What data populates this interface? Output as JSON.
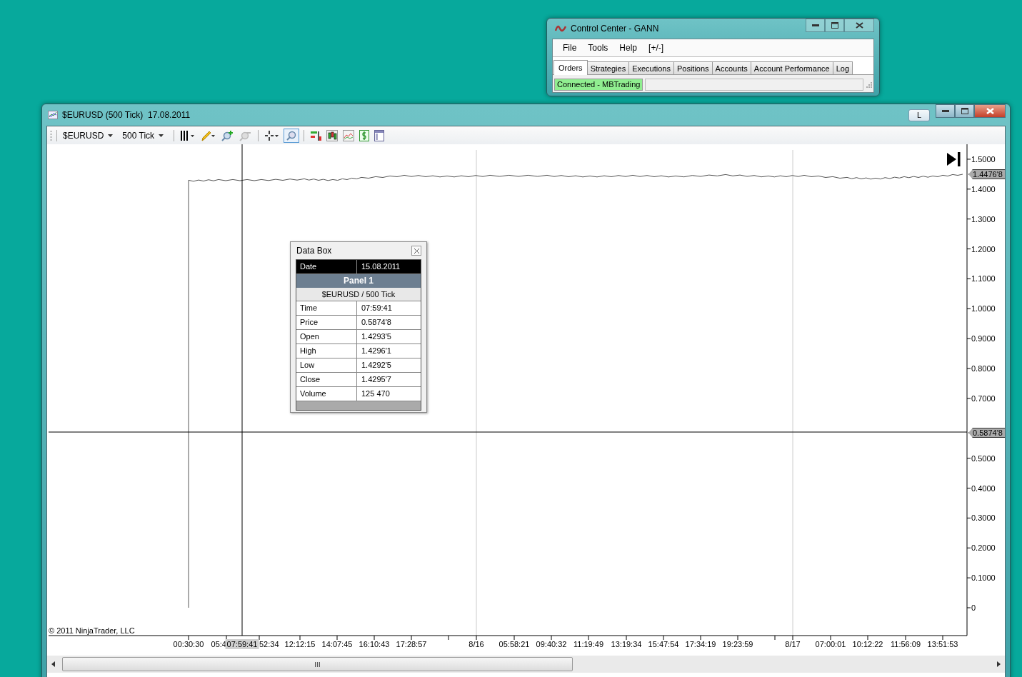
{
  "control_center": {
    "title": "Control Center - GANN",
    "menu": [
      "File",
      "Tools",
      "Help",
      "[+/-]"
    ],
    "tabs": [
      {
        "label": "Orders",
        "selected": true
      },
      {
        "label": "Strategies",
        "selected": false
      },
      {
        "label": "Executions",
        "selected": false
      },
      {
        "label": "Positions",
        "selected": false
      },
      {
        "label": "Accounts",
        "selected": false
      },
      {
        "label": "Account Performance",
        "selected": false
      },
      {
        "label": "Log",
        "selected": false
      }
    ],
    "status": "Connected - MBTrading"
  },
  "chart_window": {
    "title": "$EURUSD (500 Tick)  17.08.2011",
    "layout_button": "L",
    "toolbar": {
      "instrument": "$EURUSD",
      "interval": "500 Tick"
    },
    "price_axis": [
      "1.5000",
      "1.4000",
      "1.3000",
      "1.2000",
      "1.1000",
      "1.0000",
      "0.9000",
      "0.8000",
      "0.7000",
      "0.5000",
      "0.4000",
      "0.3000",
      "0.2000",
      "0.1000",
      "0"
    ],
    "last_price": "1.4476'8",
    "crosshair_price": "0.5874'8",
    "time_axis": [
      "00:30:30",
      "05:4",
      "52:34",
      "12:12:15",
      "14:07:45",
      "16:10:43",
      "17:28:57",
      "8/16",
      "05:58:21",
      "09:40:32",
      "11:19:49",
      "13:19:34",
      "15:47:54",
      "17:34:19",
      "19:23:59",
      "8/17",
      "07:00:01",
      "10:12:22",
      "11:56:09",
      "13:51:53"
    ],
    "crosshair_time": "07:59:41",
    "copyright": "© 2011 NinjaTrader, LLC"
  },
  "data_box": {
    "title": "Data Box",
    "date_label": "Date",
    "date_value": "15.08.2011",
    "panel": "Panel 1",
    "series": "$EURUSD / 500 Tick",
    "rows": [
      {
        "label": "Time",
        "value": "07:59:41"
      },
      {
        "label": "Price",
        "value": "0.5874'8"
      },
      {
        "label": "Open",
        "value": "1.4293'5"
      },
      {
        "label": "High",
        "value": "1.4296'1"
      },
      {
        "label": "Low",
        "value": "1.4292'5"
      },
      {
        "label": "Close",
        "value": "1.4295'7"
      },
      {
        "label": "Volume",
        "value": "125 470"
      }
    ]
  }
}
